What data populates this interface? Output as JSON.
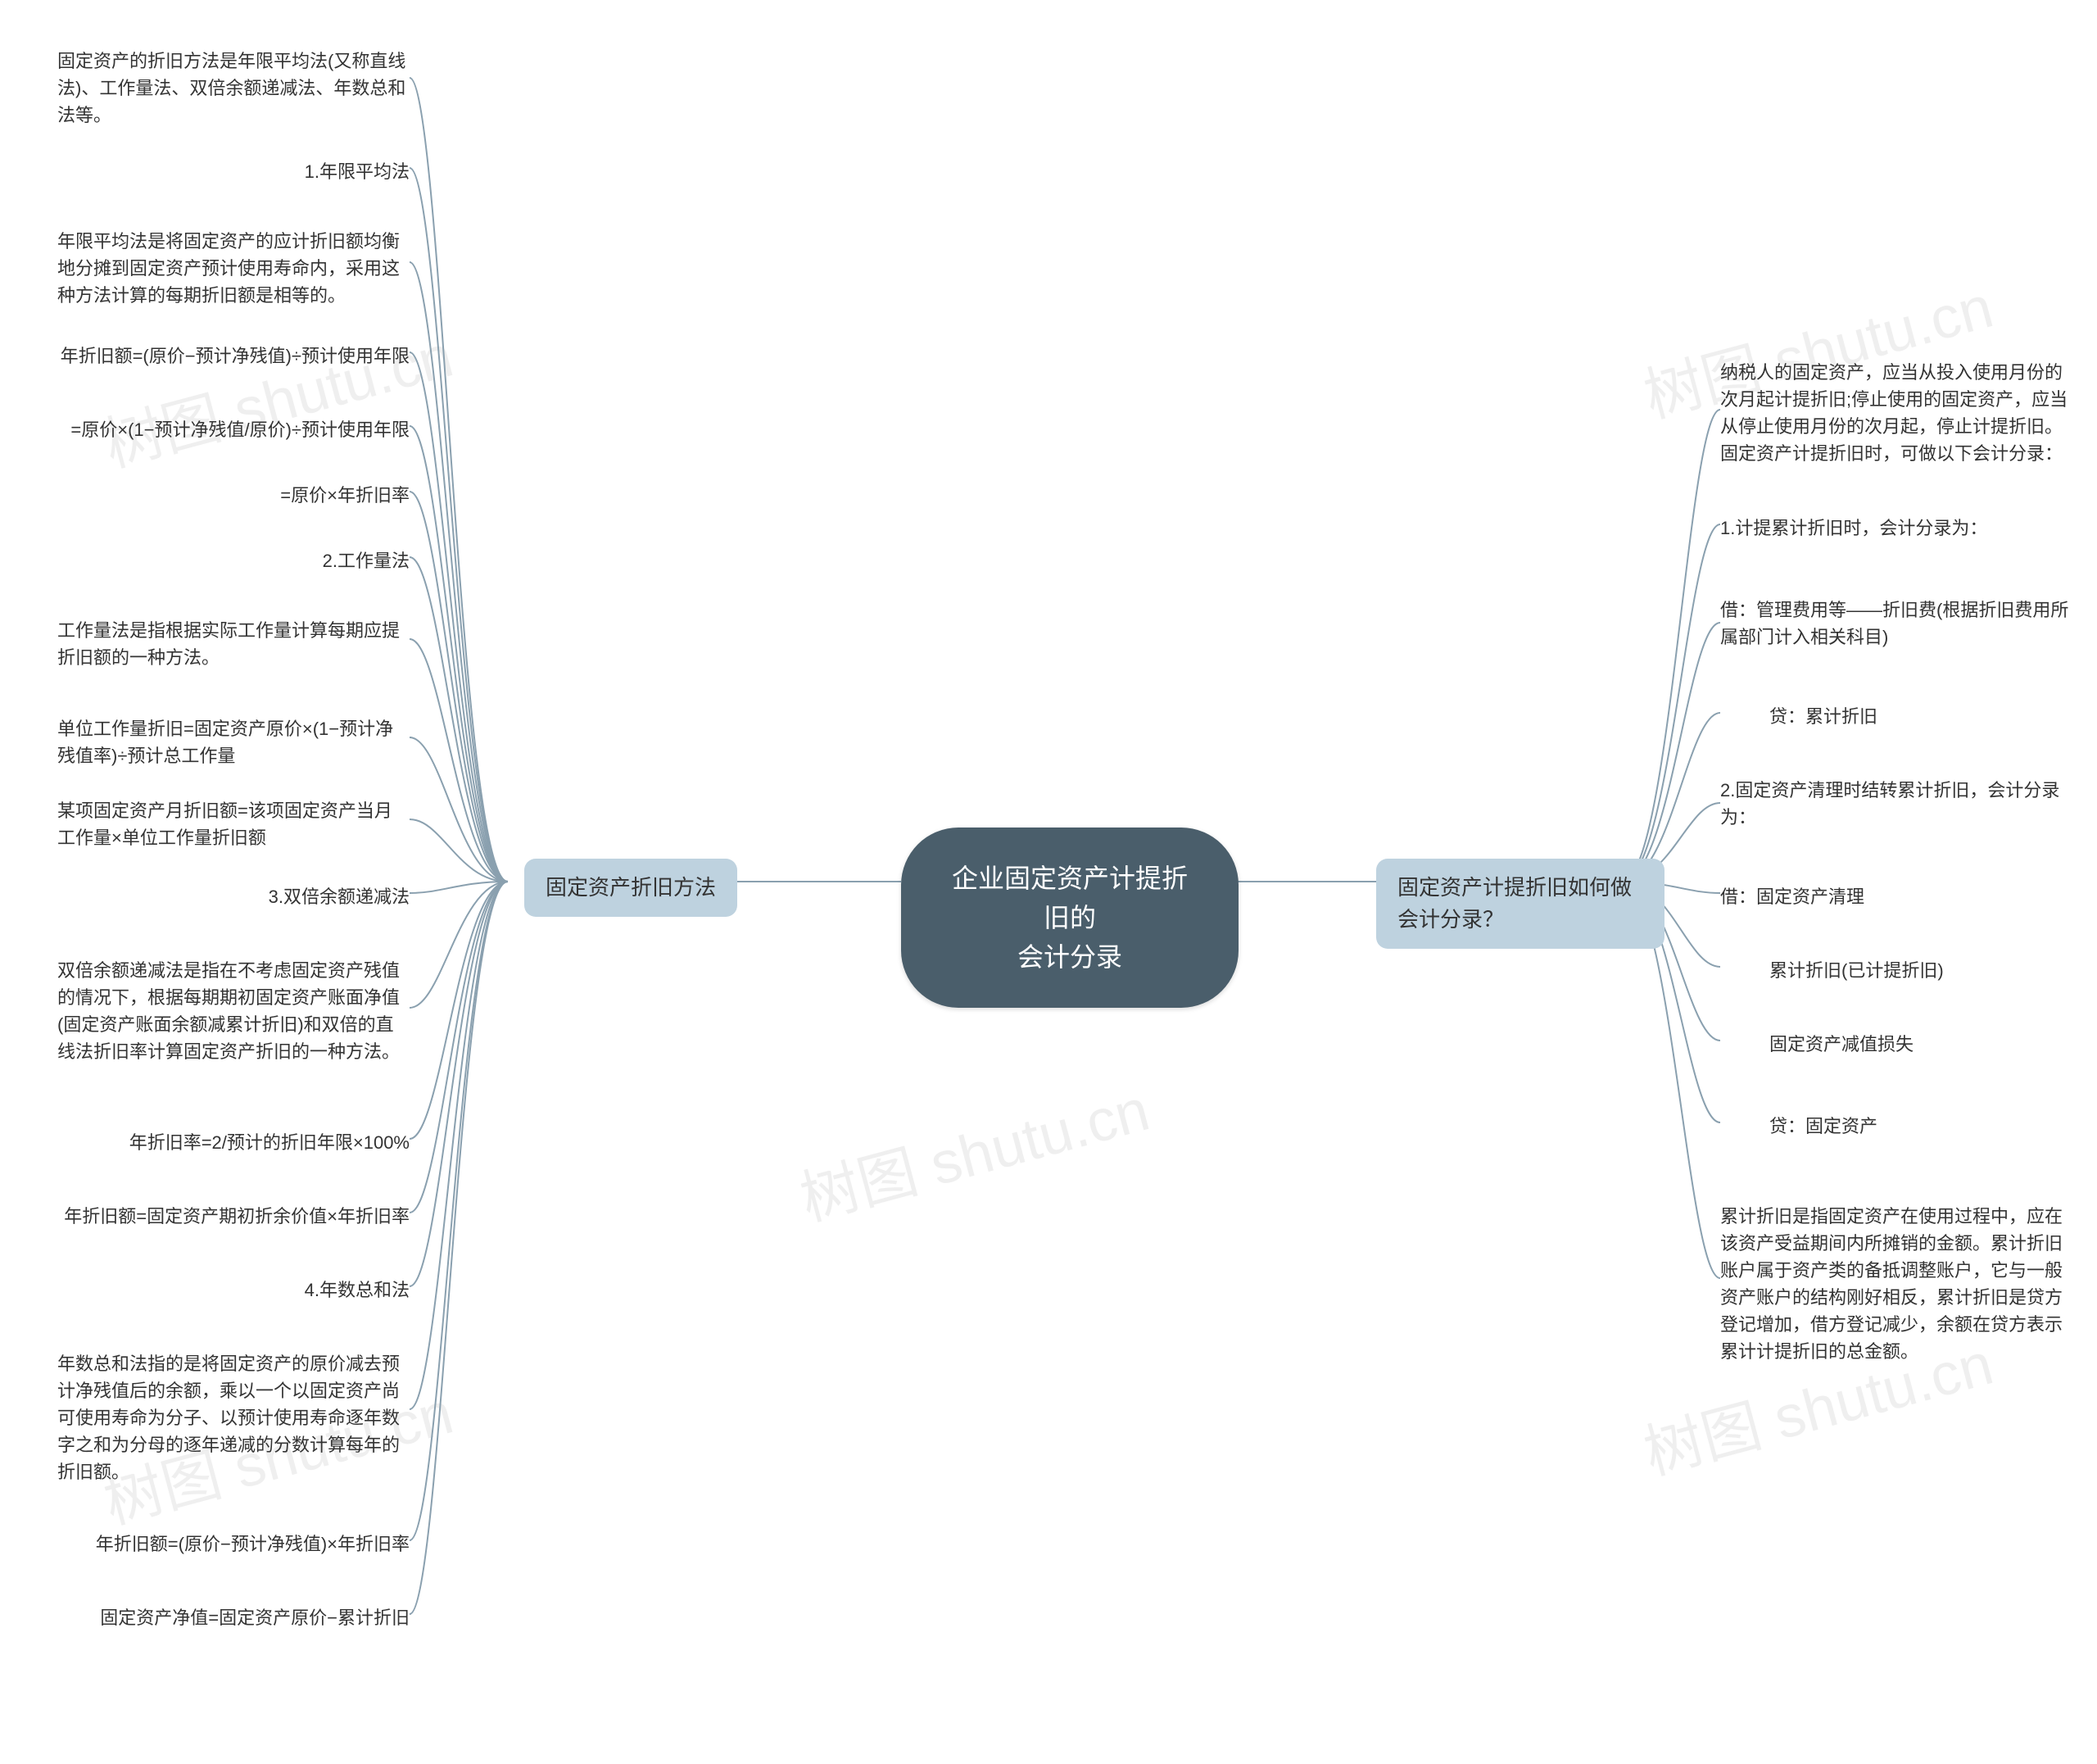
{
  "root": {
    "line1": "企业固定资产计提折旧的",
    "line2": "会计分录"
  },
  "left": {
    "label": "固定资产折旧方法",
    "items": [
      "固定资产的折旧方法是年限平均法(又称直线法)、工作量法、双倍余额递减法、年数总和法等。",
      "1.年限平均法",
      "年限平均法是将固定资产的应计折旧额均衡地分摊到固定资产预计使用寿命内，采用这种方法计算的每期折旧额是相等的。",
      "年折旧额=(原价−预计净残值)÷预计使用年限",
      "=原价×(1−预计净残值/原价)÷预计使用年限",
      "=原价×年折旧率",
      "2.工作量法",
      "工作量法是指根据实际工作量计算每期应提折旧额的一种方法。",
      "单位工作量折旧=固定资产原价×(1−预计净残值率)÷预计总工作量",
      "某项固定资产月折旧额=该项固定资产当月工作量×单位工作量折旧额",
      "3.双倍余额递减法",
      "双倍余额递减法是指在不考虑固定资产残值的情况下，根据每期期初固定资产账面净值(固定资产账面余额减累计折旧)和双倍的直线法折旧率计算固定资产折旧的一种方法。",
      "年折旧率=2/预计的折旧年限×100%",
      "年折旧额=固定资产期初折余价值×年折旧率",
      "4.年数总和法",
      "年数总和法指的是将固定资产的原价减去预计净残值后的余额，乘以一个以固定资产尚可使用寿命为分子、以预计使用寿命逐年数字之和为分母的逐年递减的分数计算每年的折旧额。",
      "年折旧额=(原价−预计净残值)×年折旧率",
      "固定资产净值=固定资产原价−累计折旧"
    ]
  },
  "right": {
    "label": "固定资产计提折旧如何做会计分录？",
    "items": [
      "纳税人的固定资产，应当从投入使用月份的次月起计提折旧;停止使用的固定资产，应当从停止使用月份的次月起，停止计提折旧。固定资产计提折旧时，可做以下会计分录：",
      "1.计提累计折旧时，会计分录为：",
      "借：管理费用等——折旧费(根据折旧费用所属部门计入相关科目)",
      "贷：累计折旧",
      "2.固定资产清理时结转累计折旧，会计分录为：",
      "借：固定资产清理",
      "累计折旧(已计提折旧)",
      "固定资产减值损失",
      "贷：固定资产",
      "累计折旧是指固定资产在使用过程中，应在该资产受益期间内所摊销的金额。累计折旧账户属于资产类的备抵调整账户，它与一般资产账户的结构刚好相反，累计折旧是贷方登记增加，借方登记减少，余额在贷方表示累计计提折旧的总金额。"
    ]
  },
  "watermark": "树图 shutu.cn"
}
